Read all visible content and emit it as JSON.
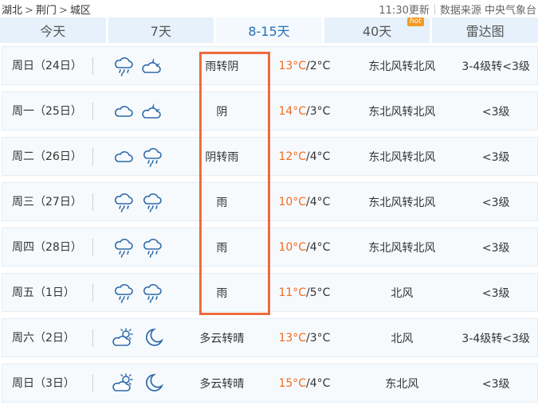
{
  "breadcrumb": [
    "湖北",
    "荆门",
    "城区"
  ],
  "update_time": "11:30更新",
  "source": "数据来源 中央气象台",
  "tabs": [
    {
      "label": "今天"
    },
    {
      "label": "7天"
    },
    {
      "label": "8-15天",
      "active": true
    },
    {
      "label": "40天",
      "badge": "hot"
    },
    {
      "label": "雷达图"
    }
  ],
  "rows": [
    {
      "date": "周日（24日）",
      "icons": [
        "rain-cloud-icon",
        "moon-cloud-icon"
      ],
      "desc": "雨转阴",
      "hi": "13°C",
      "lo": "2°C",
      "wind": "东北风转北风",
      "level": "3-4级转<3级"
    },
    {
      "date": "周一（25日）",
      "icons": [
        "cloud-icon",
        "moon-cloud-icon"
      ],
      "desc": "阴",
      "hi": "14°C",
      "lo": "3°C",
      "wind": "东北风转北风",
      "level": "<3级"
    },
    {
      "date": "周二（26日）",
      "icons": [
        "cloud-icon",
        "rain-cloud-icon"
      ],
      "desc": "阴转雨",
      "hi": "12°C",
      "lo": "4°C",
      "wind": "东北风转北风",
      "level": "<3级"
    },
    {
      "date": "周三（27日）",
      "icons": [
        "rain-cloud-icon",
        "rain-cloud-icon"
      ],
      "desc": "雨",
      "hi": "10°C",
      "lo": "4°C",
      "wind": "东北风转北风",
      "level": "<3级"
    },
    {
      "date": "周四（28日）",
      "icons": [
        "rain-cloud-icon",
        "rain-cloud-icon"
      ],
      "desc": "雨",
      "hi": "10°C",
      "lo": "4°C",
      "wind": "东北风转北风",
      "level": "<3级"
    },
    {
      "date": "周五（1日）",
      "icons": [
        "rain-cloud-icon",
        "rain-cloud-icon"
      ],
      "desc": "雨",
      "hi": "11°C",
      "lo": "5°C",
      "wind": "北风",
      "level": "<3级"
    },
    {
      "date": "周六（2日）",
      "icons": [
        "sun-cloud-icon",
        "moon-icon"
      ],
      "desc": "多云转晴",
      "hi": "13°C",
      "lo": "3°C",
      "wind": "北风",
      "level": "3-4级转<3级"
    },
    {
      "date": "周日（3日）",
      "icons": [
        "sun-cloud-icon",
        "moon-icon"
      ],
      "desc": "多云转晴",
      "hi": "15°C",
      "lo": "4°C",
      "wind": "东北风",
      "level": "<3级"
    }
  ],
  "colors": {
    "accent_tab": "#2a6fb2",
    "temp_high": "#f06b22",
    "highlight_box": "#ee6b3e"
  }
}
